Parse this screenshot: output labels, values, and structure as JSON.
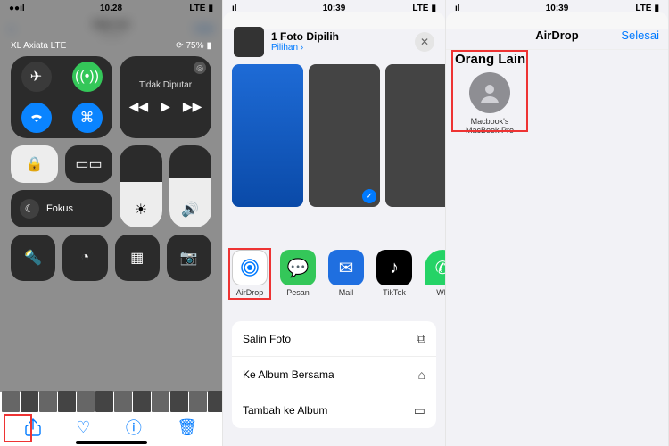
{
  "panel1": {
    "status": {
      "carrier_icon": "●●●●",
      "time": "10.28",
      "signal": "LTE",
      "batt_icon": "▮"
    },
    "header": {
      "title": "Hari ini",
      "subtitle": "10.28",
      "edit": "Edit"
    },
    "cc": {
      "carrier_label": "XL Axiata LTE",
      "battery_label": "75%",
      "media_title": "Tidak Diputar",
      "focus_label": "Fokus"
    },
    "toolbar": {
      "share": "share-icon",
      "heart": "heart-icon",
      "info": "info-icon",
      "trash": "trash-icon"
    }
  },
  "panel2": {
    "status": {
      "time": "10:39",
      "signal": "LTE"
    },
    "header": {
      "title": "1 Foto Dipilih",
      "options": "Pilihan",
      "chevron": "›"
    },
    "apps": {
      "airdrop": "AirDrop",
      "messages": "Pesan",
      "mail": "Mail",
      "tiktok": "TikTok",
      "whatsapp": "Wh"
    },
    "actions": {
      "copy": "Salin Foto",
      "shared_album": "Ke Album Bersama",
      "add_album": "Tambah ke Album"
    }
  },
  "panel3": {
    "status": {
      "time": "10:39",
      "signal": "LTE"
    },
    "header": {
      "title": "AirDrop",
      "done": "Selesai"
    },
    "section_title": "Orang Lain",
    "device_name": "Macbook's MacBook Pro"
  }
}
